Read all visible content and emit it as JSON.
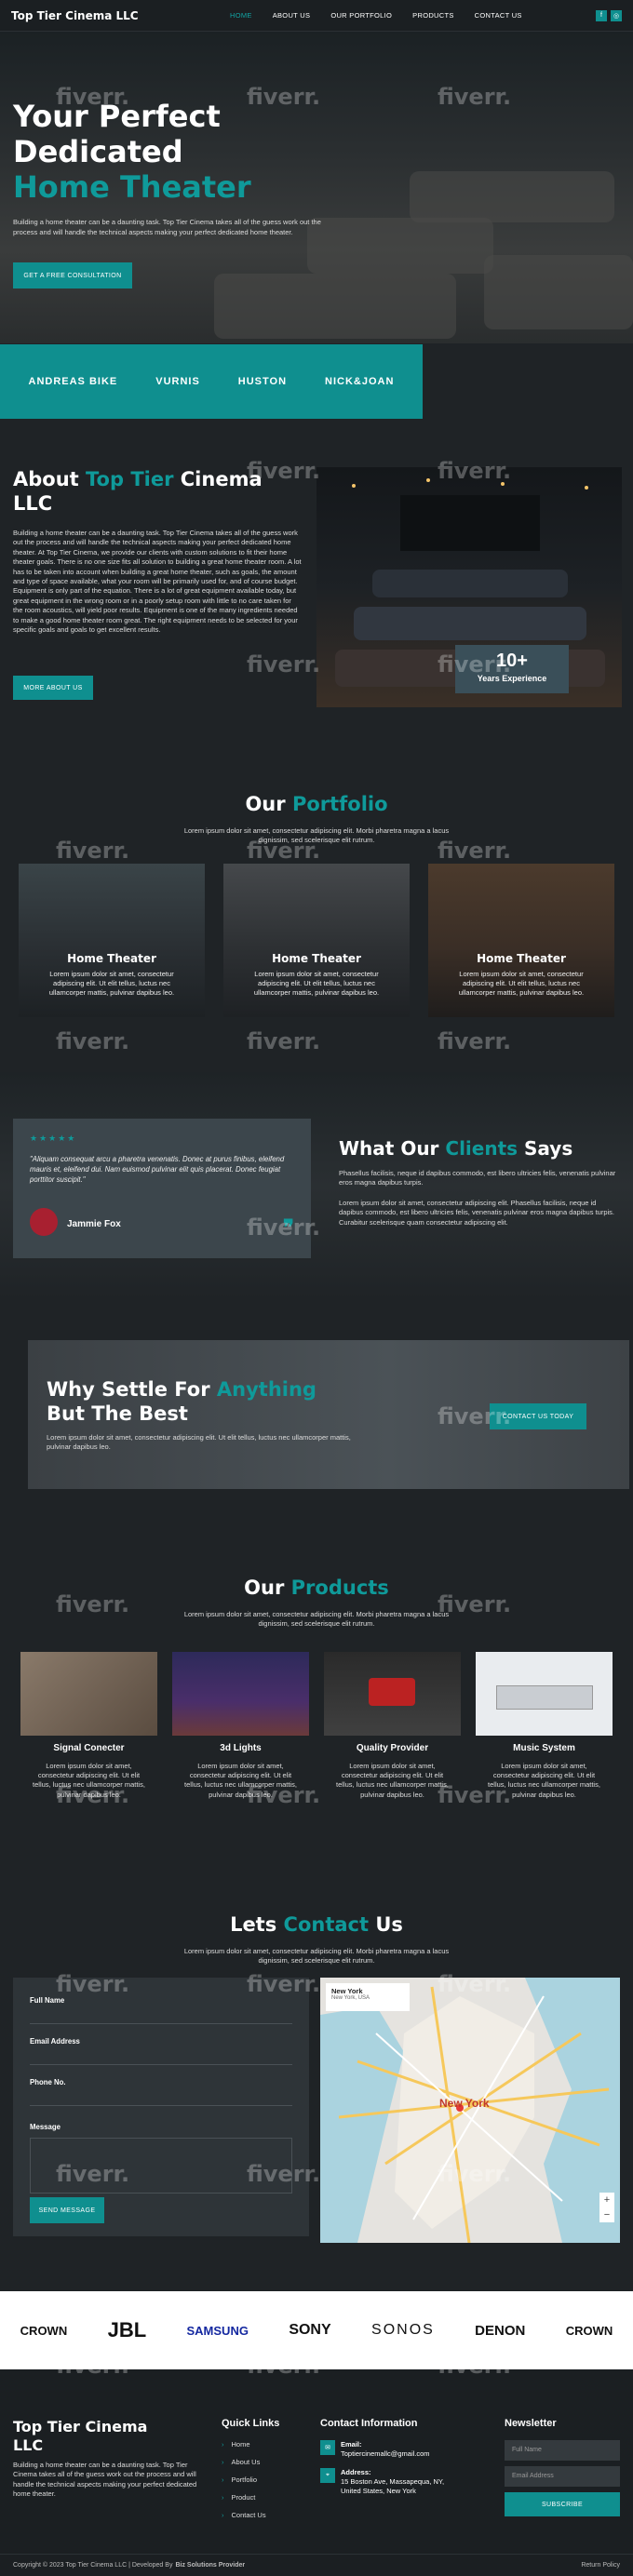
{
  "header": {
    "logo": "Top Tier Cinema LLC",
    "nav": [
      "HOME",
      "ABOUT US",
      "OUR PORTFOLIO",
      "PRODUCTS",
      "CONTACT US"
    ],
    "social": [
      "f",
      "◎"
    ]
  },
  "hero": {
    "title_1": "Your Perfect",
    "title_2": "Dedicated",
    "title_3": "Home Theater",
    "text": "Building a home theater can be a daunting task. Top Tier Cinema takes all of the guess work out the process and will handle the technical aspects making your perfect dedicated home theater.",
    "cta": "GET A FREE CONSULTATION"
  },
  "brands": [
    "ANDREAS BIKE",
    "VURNIS",
    "HUSTON",
    "NICK&JOAN"
  ],
  "about": {
    "title_1": "About",
    "title_2": "Top Tier",
    "title_3": "Cinema LLC",
    "text": "Building a home theater can be a daunting task. Top Tier Cinema takes all of the guess work out the process and will handle the technical aspects making your perfect dedicated home theater. At Top Tier Cinema, we provide our clients with custom solutions to fit their home theater goals. There is no one size fits all solution to building a great home theater room. A lot has to be taken into account when building a great home theater, such as goals, the amount and type of space available, what your room will be primarily used for, and of course budget. Equipment is only part of the equation. There is a lot of great equipment available today, but great equipment in the wrong room or in a poorly setup room with little to no care taken for the room acoustics, will yield poor results. Equipment is one of the many ingredients needed to make a good home theater room great. The right equipment needs to be selected for your specific goals and goals to get excellent results.",
    "button": "MORE ABOUT US",
    "exp_number": "10+",
    "exp_label": "Years Experience"
  },
  "portfolio": {
    "title_1": "Our",
    "title_2": "Portfolio",
    "subtitle": "Lorem ipsum dolor sit amet, consectetur adipiscing elit. Morbi pharetra magna a lacus dignissim, sed scelerisque elit rutrum.",
    "cards": [
      {
        "title": "Home Theater",
        "text": "Lorem ipsum dolor sit amet, consectetur adipiscing elit. Ut elit tellus, luctus nec ullamcorper mattis, pulvinar dapibus leo."
      },
      {
        "title": "Home Theater",
        "text": "Lorem ipsum dolor sit amet, consectetur adipiscing elit. Ut elit tellus, luctus nec ullamcorper mattis, pulvinar dapibus leo."
      },
      {
        "title": "Home Theater",
        "text": "Lorem ipsum dolor sit amet, consectetur adipiscing elit. Ut elit tellus, luctus nec ullamcorper mattis, pulvinar dapibus leo."
      }
    ]
  },
  "testimonial": {
    "stars": "★★★★★",
    "quote": "\"Aliquam consequat arcu a pharetra venenatis. Donec at purus finibus, eleifend mauris et, eleifend dui. Nam euismod pulvinar elit quis placerat. Donec feugiat porttitor suscipit.\"",
    "name": "Jammie Fox",
    "title_1": "What Our",
    "title_2": "Clients",
    "title_3": "Says",
    "text_1": "Phasellus facilisis, neque id dapibus commodo, est libero ultricies felis, venenatis pulvinar eros magna dapibus turpis.",
    "text_2": "Lorem ipsum dolor sit amet, consectetur adipiscing elit. Phasellus facilisis, neque id dapibus commodo, est libero ultricies felis, venenatis pulvinar eros magna dapibus turpis. Curabitur scelerisque quam consectetur adipiscing elit."
  },
  "cta": {
    "title_1": "Why Settle For",
    "title_2": "Anything",
    "title_3": "But The Best",
    "text": "Lorem ipsum dolor sit amet, consectetur adipiscing elit. Ut elit tellus, luctus nec ullamcorper mattis, pulvinar dapibus leo.",
    "button": "CONTACT US TODAY"
  },
  "products": {
    "title_1": "Our",
    "title_2": "Products",
    "subtitle": "Lorem ipsum dolor sit amet, consectetur adipiscing elit. Morbi pharetra magna a lacus dignissim, sed scelerisque elit rutrum.",
    "items": [
      {
        "title": "Signal Conecter",
        "text": "Lorem ipsum dolor sit amet, consectetur adipiscing elit. Ut elit tellus, luctus nec ullamcorper mattis, pulvinar dapibus leo."
      },
      {
        "title": "3d Lights",
        "text": "Lorem ipsum dolor sit amet, consectetur adipiscing elit. Ut elit tellus, luctus nec ullamcorper mattis, pulvinar dapibus leo."
      },
      {
        "title": "Quality Provider",
        "text": "Lorem ipsum dolor sit amet, consectetur adipiscing elit. Ut elit tellus, luctus nec ullamcorper mattis, pulvinar dapibus leo."
      },
      {
        "title": "Music System",
        "text": "Lorem ipsum dolor sit amet, consectetur adipiscing elit. Ut elit tellus, luctus nec ullamcorper mattis, pulvinar dapibus leo."
      }
    ]
  },
  "contact": {
    "title_1": "Lets",
    "title_2": "Contact",
    "title_3": "Us",
    "subtitle": "Lorem ipsum dolor sit amet, consectetur adipiscing elit. Morbi pharetra magna a lacus dignissim, sed scelerisque elit rutrum.",
    "fields": [
      "Full Name",
      "Email Address",
      "Phone No.",
      "Message"
    ],
    "button": "SEND MESSAGE",
    "map_label": "New York",
    "map_sub": "New York, USA",
    "map_city": "New York"
  },
  "partner_logos": [
    "CROWN",
    "JBL",
    "SAMSUNG",
    "SONY",
    "SONOS",
    "DENON",
    "CROWN"
  ],
  "footer": {
    "title": "Top Tier Cinema LLC",
    "text": "Building a home theater can be a daunting task. Top Tier Cinema takes all of the guess work out the process and will handle the technical aspects making your perfect dedicated home theater.",
    "quick_title": "Quick Links",
    "quick_links": [
      "Home",
      "About Us",
      "Portfolio",
      "Product",
      "Contact Us"
    ],
    "contact_title": "Contact Information",
    "email_label": "Email:",
    "email": "Toptiercinemallc@gmail.com",
    "address_label": "Address:",
    "address": "15 Boston Ave, Massapequa, NY, United States, New York",
    "news_title": "Newsletter",
    "news_name": "Full Name",
    "news_email": "Email Address",
    "news_button": "SUBSCRIBE",
    "copyright": "Copyright © 2023 Top Tier Cinema LLC | Developed By",
    "developer": "Biz Solutions Provider",
    "return_policy": "Return Policy"
  },
  "watermark": "fiverr."
}
